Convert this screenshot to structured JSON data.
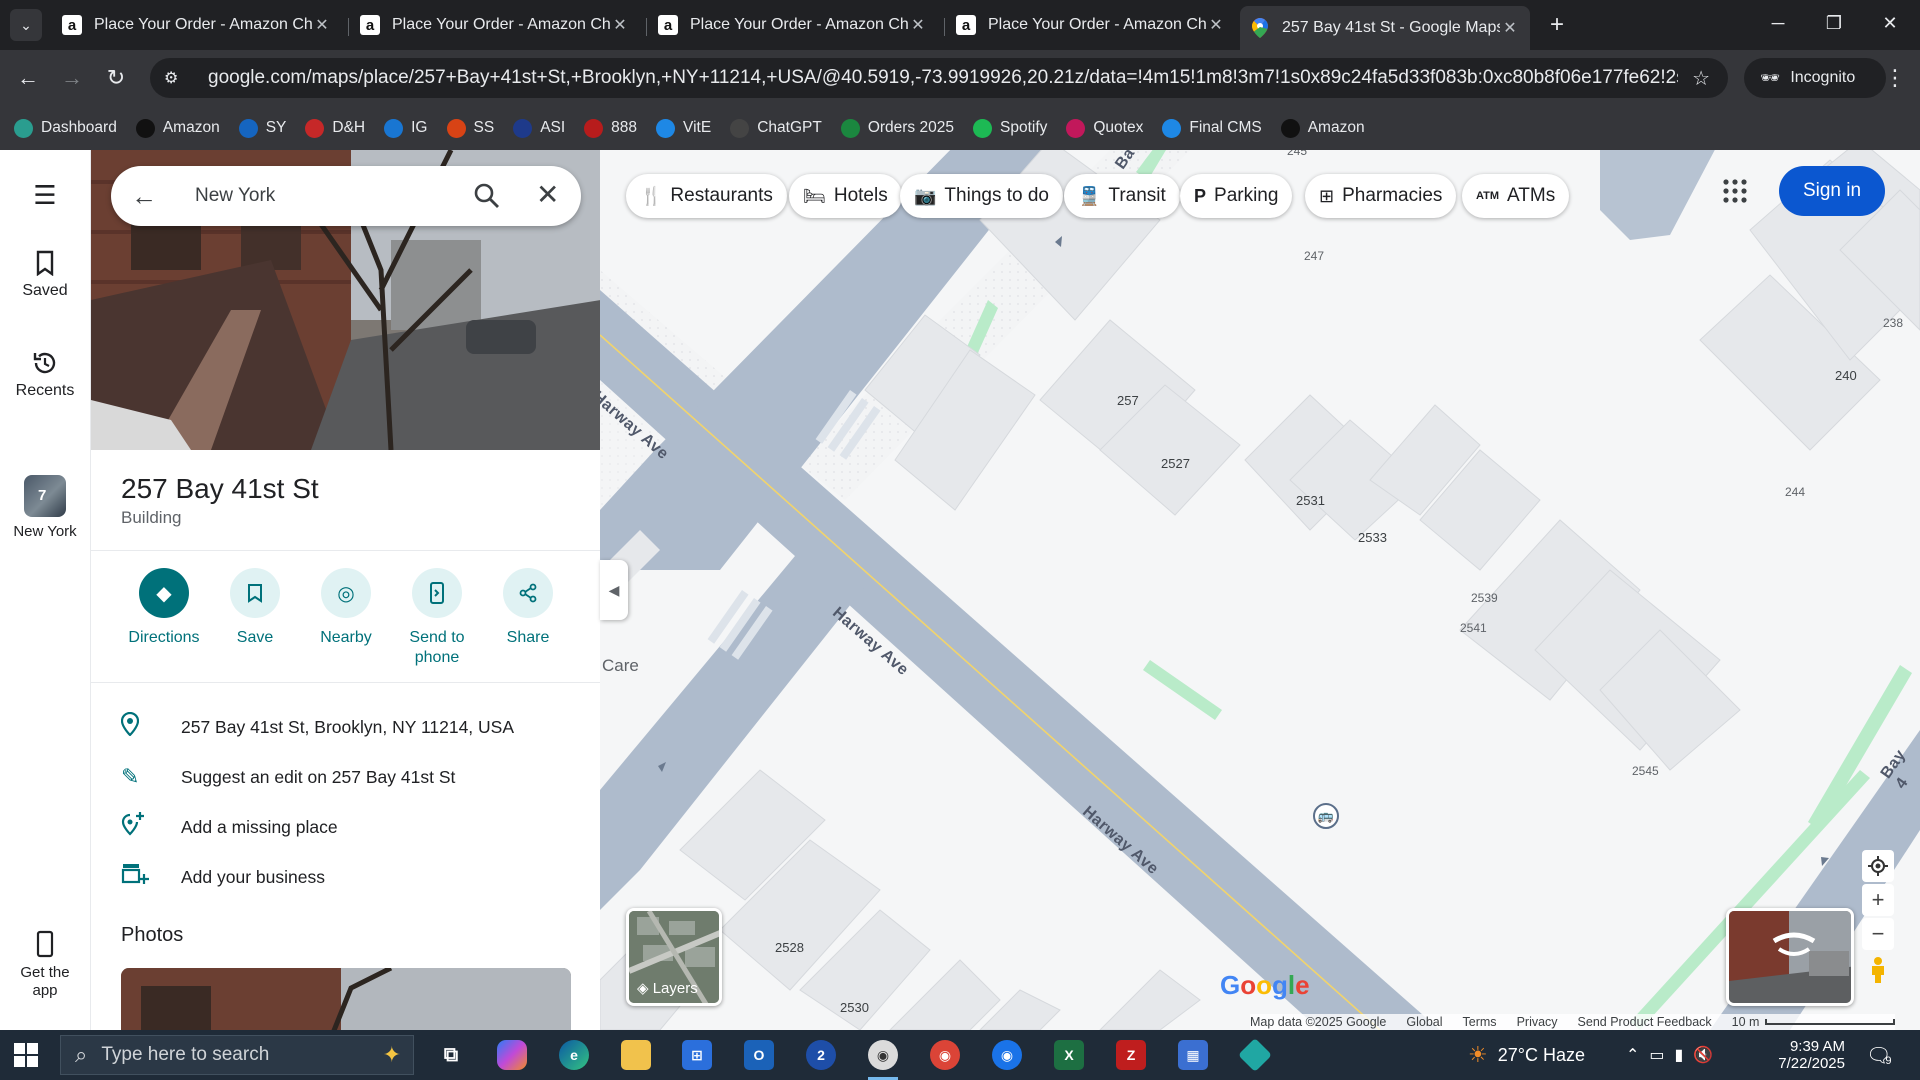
{
  "browser": {
    "tabs": [
      {
        "title": "Place Your Order - Amazon Checkout",
        "favicon": "amazon-icon",
        "active": false
      },
      {
        "title": "Place Your Order - Amazon Checkout",
        "favicon": "amazon-icon",
        "active": false
      },
      {
        "title": "Place Your Order - Amazon Checkout",
        "favicon": "amazon-icon",
        "active": false
      },
      {
        "title": "Place Your Order - Amazon Checkout",
        "favicon": "amazon-icon",
        "active": false
      },
      {
        "title": "257 Bay 41st St - Google Maps",
        "favicon": "google-maps-icon",
        "active": true
      }
    ],
    "url": "google.com/maps/place/257+Bay+41st+St,+Brooklyn,+NY+11214,+USA/@40.5919,-73.9919926,20.21z/data=!4m15!1m8!3m7!1s0x89c24fa5d33f083b:0xc80b8f06e177fe62!2sNew+York,+NY...",
    "profile": "Incognito",
    "bookmarks": [
      {
        "label": "Dashboard",
        "color": "#2a9d8f"
      },
      {
        "label": "Amazon",
        "color": "#111111"
      },
      {
        "label": "SY",
        "color": "#1565c0"
      },
      {
        "label": "D&H",
        "color": "#c62828"
      },
      {
        "label": "IG",
        "color": "#1976d2"
      },
      {
        "label": "SS",
        "color": "#d84315"
      },
      {
        "label": "ASI",
        "color": "#1e3a8a"
      },
      {
        "label": "888",
        "color": "#b71c1c"
      },
      {
        "label": "VitE",
        "color": "#1e88e5"
      },
      {
        "label": "ChatGPT",
        "color": "#444444"
      },
      {
        "label": "Orders 2025",
        "color": "#1b873f"
      },
      {
        "label": "Spotify",
        "color": "#1db954"
      },
      {
        "label": "Quotex",
        "color": "#c2185b"
      },
      {
        "label": "Final CMS",
        "color": "#1e88e5"
      },
      {
        "label": "Amazon",
        "color": "#111111"
      }
    ]
  },
  "rail": {
    "saved": "Saved",
    "recents": "Recents",
    "recent_place": "New York",
    "recent_count": "7",
    "get_app": "Get the app"
  },
  "panel": {
    "search_value": "New York",
    "title": "257 Bay 41st St",
    "subtitle": "Building",
    "actions": [
      {
        "label": "Directions",
        "icon": "directions-icon"
      },
      {
        "label": "Save",
        "icon": "bookmark-icon"
      },
      {
        "label": "Nearby",
        "icon": "nearby-icon"
      },
      {
        "label": "Send to phone",
        "icon": "send-to-phone-icon"
      },
      {
        "label": "Share",
        "icon": "share-icon"
      }
    ],
    "info": [
      {
        "text": "257 Bay 41st St, Brooklyn, NY 11214, USA",
        "icon": "location-pin-icon"
      },
      {
        "text": "Suggest an edit on 257 Bay 41st St",
        "icon": "pencil-icon"
      },
      {
        "text": "Add a missing place",
        "icon": "add-place-icon"
      },
      {
        "text": "Add your business",
        "icon": "add-business-icon"
      }
    ],
    "photos_heading": "Photos"
  },
  "map": {
    "chips": [
      {
        "label": "Restaurants",
        "icon": "restaurant-icon"
      },
      {
        "label": "Hotels",
        "icon": "hotel-icon"
      },
      {
        "label": "Things to do",
        "icon": "camera-icon"
      },
      {
        "label": "Transit",
        "icon": "transit-icon"
      },
      {
        "label": "Parking",
        "icon": "parking-icon"
      },
      {
        "label": "Pharmacies",
        "icon": "pharmacy-icon"
      },
      {
        "label": "ATMs",
        "icon": "atm-icon"
      }
    ],
    "sign_in": "Sign in",
    "layers": "Layers",
    "street_name": "Harway Ave",
    "street_bay": "Bay 4",
    "street_ba": "Ba",
    "care_label": "Care",
    "building_numbers": [
      "245",
      "247",
      "238",
      "240",
      "257",
      "2527",
      "2531",
      "2533",
      "244",
      "2539",
      "2541",
      "2545",
      "2528",
      "2530"
    ],
    "google_logo": "Google",
    "footer": [
      "Map data ©2025 Google",
      "Global",
      "Terms",
      "Privacy",
      "Send Product Feedback"
    ],
    "scale": "10 m"
  },
  "taskbar": {
    "search_placeholder": "Type here to search",
    "weather": "27°C  Haze",
    "time": "9:39 AM",
    "date": "7/22/2025",
    "notifications": "9"
  }
}
